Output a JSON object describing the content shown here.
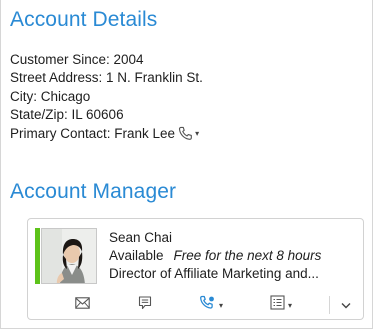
{
  "account_details": {
    "title": "Account Details",
    "customer_since": "Customer Since: 2004",
    "street_address": "Street Address: 1 N. Franklin St.",
    "city": "City: Chicago",
    "state_zip": "State/Zip: IL 60606",
    "primary_contact": "Primary Contact: Frank Lee",
    "caret": "▾"
  },
  "account_manager": {
    "title": "Account Manager",
    "name": "Sean Chai",
    "presence": "Available",
    "availability": "Free for the next 8 hours",
    "job_title": "Director of Affiliate Marketing and...",
    "presence_color": "#5dc31a",
    "actions": {
      "email_icon": "envelope-icon",
      "im_icon": "chat-icon",
      "call_icon": "phone-icon",
      "more_icon": "contact-card-icon",
      "dropdown_caret": "▾",
      "expand_caret": "⌄"
    }
  },
  "colors": {
    "accent": "#2a8ad4",
    "text": "#1e1e1e"
  }
}
